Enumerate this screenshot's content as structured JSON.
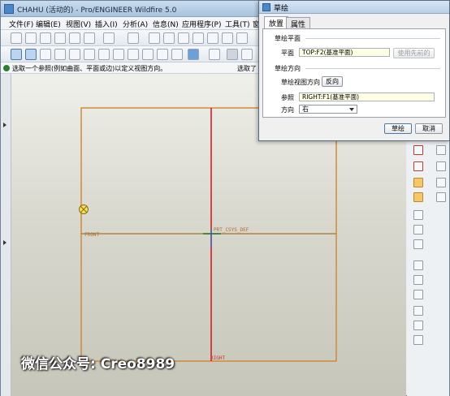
{
  "window": {
    "title": "CHAHU (活动的) - Pro/ENGINEER Wildfire 5.0"
  },
  "menu": [
    {
      "label": "文件(F)"
    },
    {
      "label": "编辑(E)"
    },
    {
      "label": "视图(V)"
    },
    {
      "label": "插入(I)"
    },
    {
      "label": "分析(A)"
    },
    {
      "label": "信息(N)"
    },
    {
      "label": "应用程序(P)"
    },
    {
      "label": "工具(T)"
    },
    {
      "label": "窗"
    }
  ],
  "status": {
    "message": "选取一个参照(例如曲面、平面或边)以定义视图方向。",
    "right_text": "选取了"
  },
  "canvas": {
    "datum_labels": {
      "front": "FRONT",
      "csys": "PRT_CSYS_DEF",
      "right": "RIGHT"
    }
  },
  "watermark": "微信公众号: Creo8989",
  "dialog": {
    "title": "草绘",
    "tabs": [
      {
        "label": "放置"
      },
      {
        "label": "属性"
      }
    ],
    "sketch_plane_group": "草绘平面",
    "plane_label": "平面",
    "plane_value": "TOP:F2(基准平面)",
    "use_previous_button": "使用先前的",
    "orientation_group": "草绘方向",
    "view_direction_label": "草绘视图方向",
    "flip_button": "反向",
    "reference_label": "参照",
    "reference_value": "RIGHT:F1(基准平面)",
    "direction_label": "方向",
    "direction_value": "右",
    "sketch_button": "草绘",
    "cancel_button": "取消"
  },
  "colors": {
    "datum_plane": "#d08a3c",
    "axis_red": "#d21414",
    "canvas_top": "#eff0ea",
    "canvas_bottom": "#c6c6ba"
  }
}
